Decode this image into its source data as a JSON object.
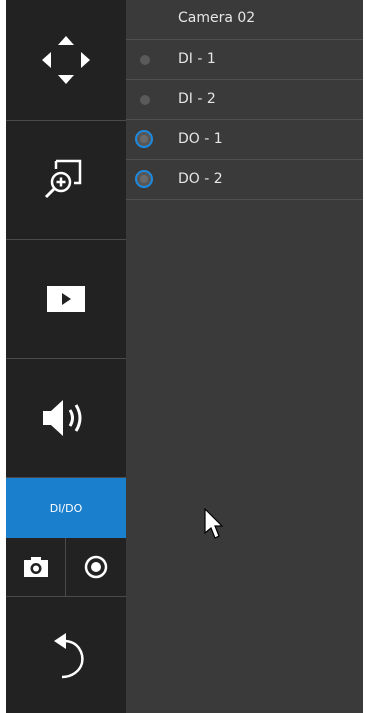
{
  "toolbar": {
    "items": [
      {
        "name": "ptz",
        "icon": "move-arrows-icon"
      },
      {
        "name": "digital-zoom",
        "icon": "zoom-in-icon"
      },
      {
        "name": "playback",
        "icon": "play-icon"
      },
      {
        "name": "audio",
        "icon": "speaker-icon"
      },
      {
        "name": "dido",
        "label": "DI/DO",
        "active": true
      },
      {
        "name": "snapshot",
        "icon": "camera-icon"
      },
      {
        "name": "record",
        "icon": "record-icon"
      },
      {
        "name": "back",
        "icon": "undo-arrow-icon"
      }
    ],
    "accent_color": "#1a7fcd"
  },
  "panel": {
    "camera_title": "Camera 02",
    "inputs": [
      {
        "label": "DI - 1"
      },
      {
        "label": "DI - 2"
      }
    ],
    "outputs": [
      {
        "label": "DO - 1"
      },
      {
        "label": "DO - 2"
      }
    ]
  }
}
